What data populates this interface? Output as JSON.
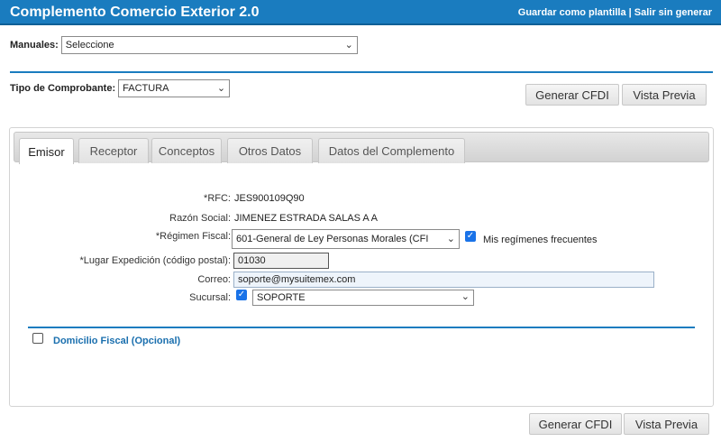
{
  "header": {
    "title": "Complemento Comercio Exterior 2.0",
    "save_template": "Guardar como plantilla",
    "separator": " | ",
    "exit": "Salir sin generar"
  },
  "manuales": {
    "label": "Manuales:",
    "selected": "Seleccione"
  },
  "tipo_comprobante": {
    "label": "Tipo de Comprobante:",
    "selected": "FACTURA"
  },
  "buttons": {
    "generar": "Generar CFDI",
    "vista_previa": "Vista Previa"
  },
  "tabs": [
    {
      "label": "Emisor",
      "active": true
    },
    {
      "label": "Receptor",
      "active": false
    },
    {
      "label": "Conceptos",
      "active": false
    },
    {
      "label": "Otros Datos",
      "active": false
    },
    {
      "label": "Datos del Complemento",
      "active": false
    }
  ],
  "emisor": {
    "rfc_label": "*RFC:",
    "rfc_value": "JES900109Q90",
    "razon_label": "Razón Social:",
    "razon_value": "JIMENEZ ESTRADA SALAS A A",
    "regimen_label": "*Régimen Fiscal:",
    "regimen_selected": "601-General de Ley Personas Morales (CFI",
    "regimen_frecuentes_checked": true,
    "regimen_frecuentes_label": "Mis regímenes frecuentes",
    "lugar_label": "*Lugar Expedición (código postal):",
    "lugar_value": "01030",
    "correo_label": "Correo:",
    "correo_value": "soporte@mysuitemex.com",
    "sucursal_label": "Sucursal:",
    "sucursal_checked": true,
    "sucursal_selected": "SOPORTE"
  },
  "domicilio": {
    "checked": false,
    "label": "Domicilio Fiscal (Opcional)"
  },
  "colors": {
    "brand_blue": "#1a7cbf",
    "link_blue": "#1a6fae",
    "checkbox_blue": "#1a73e8"
  }
}
